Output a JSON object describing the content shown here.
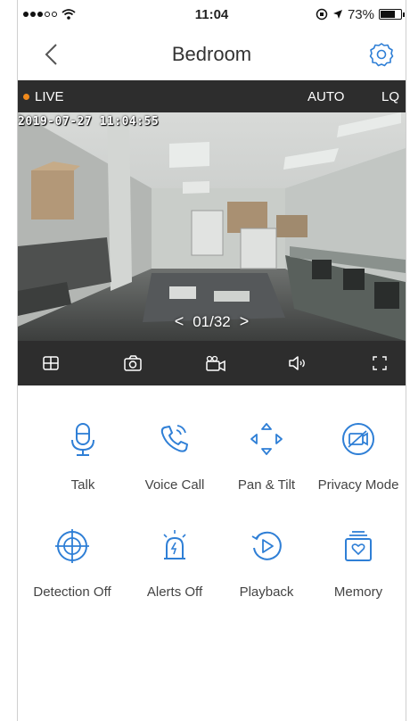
{
  "status_bar": {
    "time": "11:04",
    "battery": "73%",
    "battery_level": 0.73
  },
  "nav": {
    "title": "Bedroom"
  },
  "video": {
    "live_label": "LIVE",
    "quality_auto": "AUTO",
    "quality_lq": "LQ",
    "timestamp": "2019-07-27 11:04:55",
    "pager": "01/32",
    "pager_prev": "<",
    "pager_next": ">"
  },
  "toolbar_icons": [
    "grid-view-icon",
    "snapshot-icon",
    "record-video-icon",
    "speaker-icon",
    "fullscreen-icon"
  ],
  "controls": [
    {
      "label": "Talk",
      "icon": "microphone-icon"
    },
    {
      "label": "Voice Call",
      "icon": "phone-call-icon"
    },
    {
      "label": "Pan & Tilt",
      "icon": "pan-tilt-icon"
    },
    {
      "label": "Privacy Mode",
      "icon": "privacy-camera-off-icon"
    },
    {
      "label": "Detection Off",
      "icon": "detection-target-icon"
    },
    {
      "label": "Alerts Off",
      "icon": "alarm-light-icon"
    },
    {
      "label": "Playback",
      "icon": "playback-icon"
    },
    {
      "label": "Memory",
      "icon": "memory-card-icon"
    }
  ],
  "colors": {
    "accent": "#2f7fd6",
    "live_dot": "#f08a1c",
    "bar_bg": "#2d2d2d"
  }
}
